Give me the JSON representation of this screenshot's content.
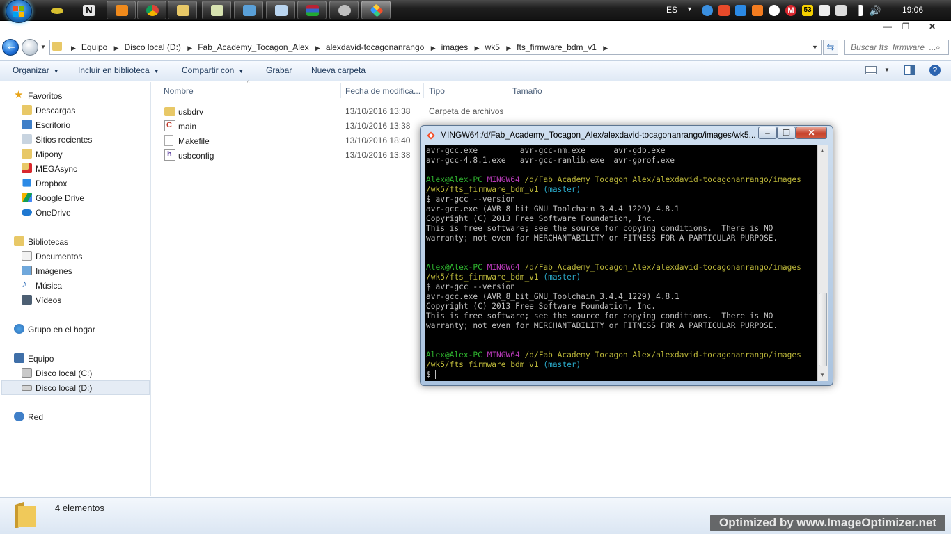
{
  "taskbar": {
    "language": "ES",
    "clock": "19:06",
    "mega_badge": "53"
  },
  "explorer": {
    "breadcrumb": [
      "Equipo",
      "Disco local (D:)",
      "Fab_Academy_Tocagon_Alex",
      "alexdavid-tocagonanrango",
      "images",
      "wk5",
      "fts_firmware_bdm_v1"
    ],
    "search_placeholder": "Buscar fts_firmware_...",
    "commands": {
      "organize": "Organizar",
      "include": "Incluir en biblioteca",
      "share": "Compartir con",
      "burn": "Grabar",
      "new_folder": "Nueva carpeta"
    },
    "nav": {
      "favorites": "Favoritos",
      "downloads": "Descargas",
      "desktop": "Escritorio",
      "recent": "Sitios recientes",
      "mipony": "Mipony",
      "megasync": "MEGAsync",
      "dropbox": "Dropbox",
      "gdrive": "Google Drive",
      "onedrive": "OneDrive",
      "libraries": "Bibliotecas",
      "documents": "Documentos",
      "images": "Imágenes",
      "music": "Música",
      "videos": "Vídeos",
      "homegroup": "Grupo en el hogar",
      "computer": "Equipo",
      "disk_c": "Disco local (C:)",
      "disk_d": "Disco local (D:)",
      "network": "Red"
    },
    "columns": {
      "name": "Nombre",
      "date": "Fecha de modifica...",
      "type": "Tipo",
      "size": "Tamaño"
    },
    "files": [
      {
        "name": "usbdrv",
        "date": "13/10/2016 13:38",
        "type": "Carpeta de archivos"
      },
      {
        "name": "main",
        "date": "13/10/2016 13:38",
        "type": ""
      },
      {
        "name": "Makefile",
        "date": "13/10/2016 18:40",
        "type": ""
      },
      {
        "name": "usbconfig",
        "date": "13/10/2016 13:38",
        "type": ""
      }
    ],
    "status": "4 elementos"
  },
  "terminal": {
    "title": "MINGW64:/d/Fab_Academy_Tocagon_Alex/alexdavid-tocagonanrango/images/wk5...",
    "ls_line1": "avr-gcc.exe         avr-gcc-nm.exe      avr-gdb.exe",
    "ls_line2": "avr-gcc-4.8.1.exe   avr-gcc-ranlib.exe  avr-gprof.exe",
    "user": "Alex@Alex-PC",
    "env": "MINGW64",
    "path1": "/d/Fab_Academy_Tocagon_Alex/alexdavid-tocagonanrango/images",
    "path2": "/wk5/fts_firmware_bdm_v1",
    "branch": "(master)",
    "cmd": "$ avr-gcc --version",
    "out1": "avr-gcc.exe (AVR_8_bit_GNU_Toolchain_3.4.4_1229) 4.8.1",
    "out2": "Copyright (C) 2013 Free Software Foundation, Inc.",
    "out3": "This is free software; see the source for copying conditions.  There is NO",
    "out4": "warranty; not even for MERCHANTABILITY or FITNESS FOR A PARTICULAR PURPOSE.",
    "prompt": "$ "
  },
  "watermark": "Optimized by www.ImageOptimizer.net"
}
